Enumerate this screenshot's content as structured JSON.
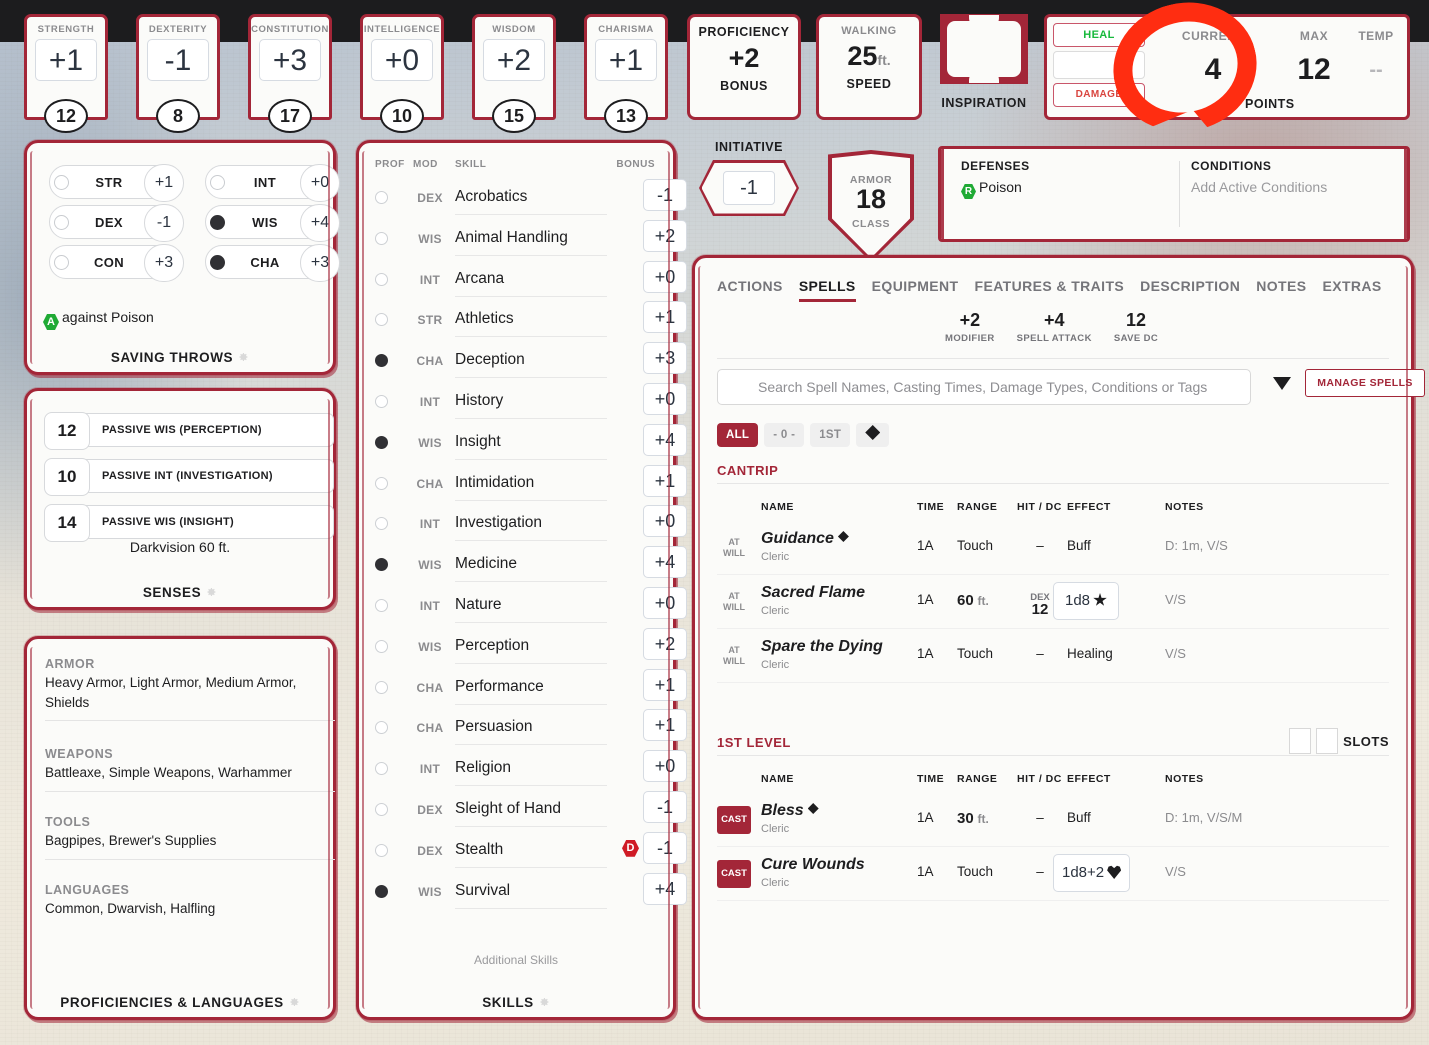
{
  "abilities": [
    {
      "name": "STRENGTH",
      "mod": "+1",
      "score": "12"
    },
    {
      "name": "DEXTERITY",
      "mod": "-1",
      "score": "8"
    },
    {
      "name": "CONSTITUTION",
      "mod": "+3",
      "score": "17"
    },
    {
      "name": "INTELLIGENCE",
      "mod": "+0",
      "score": "10"
    },
    {
      "name": "WISDOM",
      "mod": "+2",
      "score": "15"
    },
    {
      "name": "CHARISMA",
      "mod": "+1",
      "score": "13"
    }
  ],
  "proficiency": {
    "top": "PROFICIENCY",
    "value": "+2",
    "bottom": "BONUS"
  },
  "speed": {
    "top": "WALKING",
    "value": "25",
    "unit": "ft.",
    "bottom": "SPEED"
  },
  "inspiration": {
    "label": "INSPIRATION"
  },
  "hit_points": {
    "heal_label": "HEAL",
    "damage_label": "DAMAGE",
    "current_label": "CURRENT",
    "current_value": "4",
    "max_label": "MAX",
    "max_value": "12",
    "temp_label": "TEMP",
    "temp_value": "--",
    "footer": "HIT POINTS"
  },
  "saving_throws": {
    "footer": "SAVING THROWS",
    "rows": [
      {
        "name": "STR",
        "bonus": "+1",
        "proficient": false
      },
      {
        "name": "INT",
        "bonus": "+0",
        "proficient": false
      },
      {
        "name": "DEX",
        "bonus": "-1",
        "proficient": false
      },
      {
        "name": "WIS",
        "bonus": "+4",
        "proficient": true
      },
      {
        "name": "CON",
        "bonus": "+3",
        "proficient": false
      },
      {
        "name": "CHA",
        "bonus": "+3",
        "proficient": true
      }
    ],
    "note": "against Poison",
    "note_badge": "A"
  },
  "senses": {
    "footer": "SENSES",
    "rows": [
      {
        "value": "12",
        "label": "PASSIVE WIS (PERCEPTION)"
      },
      {
        "value": "10",
        "label": "PASSIVE INT (INVESTIGATION)"
      },
      {
        "value": "14",
        "label": "PASSIVE WIS (INSIGHT)"
      }
    ],
    "extra": "Darkvision 60 ft."
  },
  "proficiencies": {
    "footer": "PROFICIENCIES & LANGUAGES",
    "groups": [
      {
        "heading": "ARMOR",
        "content": "Heavy Armor, Light Armor, Medium Armor, Shields"
      },
      {
        "heading": "WEAPONS",
        "content": "Battleaxe, Simple Weapons, Warhammer"
      },
      {
        "heading": "TOOLS",
        "content": "Bagpipes, Brewer's Supplies"
      },
      {
        "heading": "LANGUAGES",
        "content": "Common, Dwarvish, Halfling"
      }
    ]
  },
  "skills": {
    "footer": "SKILLS",
    "headers": {
      "prof": "PROF",
      "mod": "MOD",
      "skill": "SKILL",
      "bonus": "BONUS"
    },
    "additional": "Additional Skills",
    "rows": [
      {
        "proficient": false,
        "mod": "DEX",
        "name": "Acrobatics",
        "bonus": "-1"
      },
      {
        "proficient": false,
        "mod": "WIS",
        "name": "Animal Handling",
        "bonus": "+2"
      },
      {
        "proficient": false,
        "mod": "INT",
        "name": "Arcana",
        "bonus": "+0"
      },
      {
        "proficient": false,
        "mod": "STR",
        "name": "Athletics",
        "bonus": "+1"
      },
      {
        "proficient": true,
        "mod": "CHA",
        "name": "Deception",
        "bonus": "+3"
      },
      {
        "proficient": false,
        "mod": "INT",
        "name": "History",
        "bonus": "+0"
      },
      {
        "proficient": true,
        "mod": "WIS",
        "name": "Insight",
        "bonus": "+4"
      },
      {
        "proficient": false,
        "mod": "CHA",
        "name": "Intimidation",
        "bonus": "+1"
      },
      {
        "proficient": false,
        "mod": "INT",
        "name": "Investigation",
        "bonus": "+0"
      },
      {
        "proficient": true,
        "mod": "WIS",
        "name": "Medicine",
        "bonus": "+4"
      },
      {
        "proficient": false,
        "mod": "INT",
        "name": "Nature",
        "bonus": "+0"
      },
      {
        "proficient": false,
        "mod": "WIS",
        "name": "Perception",
        "bonus": "+2"
      },
      {
        "proficient": false,
        "mod": "CHA",
        "name": "Performance",
        "bonus": "+1"
      },
      {
        "proficient": false,
        "mod": "CHA",
        "name": "Persuasion",
        "bonus": "+1"
      },
      {
        "proficient": false,
        "mod": "INT",
        "name": "Religion",
        "bonus": "+0"
      },
      {
        "proficient": false,
        "mod": "DEX",
        "name": "Sleight of Hand",
        "bonus": "-1"
      },
      {
        "proficient": false,
        "mod": "DEX",
        "name": "Stealth",
        "bonus": "-1",
        "disadvantage": "D"
      },
      {
        "proficient": true,
        "mod": "WIS",
        "name": "Survival",
        "bonus": "+4"
      }
    ]
  },
  "initiative": {
    "label": "INITIATIVE",
    "value": "-1"
  },
  "armor_class": {
    "top": "ARMOR",
    "value": "18",
    "bottom": "CLASS"
  },
  "defenses": {
    "heading": "DEFENSES",
    "badge": "R",
    "value": "Poison"
  },
  "conditions": {
    "heading": "CONDITIONS",
    "value": "Add Active Conditions"
  },
  "tabs": [
    {
      "label": "ACTIONS",
      "active": false
    },
    {
      "label": "SPELLS",
      "active": true
    },
    {
      "label": "EQUIPMENT",
      "active": false
    },
    {
      "label": "FEATURES & TRAITS",
      "active": false
    },
    {
      "label": "DESCRIPTION",
      "active": false
    },
    {
      "label": "NOTES",
      "active": false
    },
    {
      "label": "EXTRAS",
      "active": false
    }
  ],
  "spell_stats": [
    {
      "value": "+2",
      "label": "MODIFIER"
    },
    {
      "value": "+4",
      "label": "SPELL ATTACK"
    },
    {
      "value": "12",
      "label": "SAVE DC"
    }
  ],
  "search": {
    "placeholder": "Search Spell Names, Casting Times, Damage Types, Conditions or Tags",
    "value": ""
  },
  "manage_spells_label": "MANAGE SPELLS",
  "filter_pills": [
    {
      "label": "ALL",
      "active": true
    },
    {
      "label": "- 0 -",
      "active": false
    },
    {
      "label": "1ST",
      "active": false
    },
    {
      "label": "◆",
      "active": false
    }
  ],
  "spell_table_headers": {
    "name": "NAME",
    "time": "TIME",
    "range": "RANGE",
    "hit": "HIT / DC",
    "effect": "EFFECT",
    "notes": "NOTES"
  },
  "spell_sections": [
    {
      "title": "CANTRIP",
      "has_slots": false,
      "spells": [
        {
          "cast_label": "AT WILL",
          "cast_type": "atwill",
          "name": "Guidance",
          "concentration": true,
          "source": "Cleric",
          "time": "1A",
          "range": "Touch",
          "range_bold": "",
          "hit": "–",
          "dc_label": "",
          "dc_value": "",
          "effect": "Buff",
          "effect_boxed": false,
          "notes": "D: 1m, V/S"
        },
        {
          "cast_label": "AT WILL",
          "cast_type": "atwill",
          "name": "Sacred Flame",
          "concentration": false,
          "source": "Cleric",
          "time": "1A",
          "range": "ft.",
          "range_bold": "60",
          "hit": "",
          "dc_label": "DEX",
          "dc_value": "12",
          "effect": "1d8",
          "effect_boxed": true,
          "effect_icon": "damage-burst-icon",
          "notes": "V/S"
        },
        {
          "cast_label": "AT WILL",
          "cast_type": "atwill",
          "name": "Spare the Dying",
          "concentration": false,
          "source": "Cleric",
          "time": "1A",
          "range": "Touch",
          "range_bold": "",
          "hit": "–",
          "dc_label": "",
          "dc_value": "",
          "effect": "Healing",
          "effect_boxed": false,
          "notes": "V/S"
        }
      ]
    },
    {
      "title": "1ST LEVEL",
      "has_slots": true,
      "slots_label": "SLOTS",
      "slots_count": 2,
      "spells": [
        {
          "cast_label": "CAST",
          "cast_type": "cast",
          "name": "Bless",
          "concentration": true,
          "source": "Cleric",
          "time": "1A",
          "range": "ft.",
          "range_bold": "30",
          "hit": "–",
          "dc_label": "",
          "dc_value": "",
          "effect": "Buff",
          "effect_boxed": false,
          "notes": "D: 1m, V/S/M"
        },
        {
          "cast_label": "CAST",
          "cast_type": "cast",
          "name": "Cure Wounds",
          "concentration": false,
          "source": "Cleric",
          "time": "1A",
          "range": "Touch",
          "range_bold": "",
          "hit": "–",
          "dc_label": "",
          "dc_value": "",
          "effect": "1d8+2",
          "effect_boxed": true,
          "effect_icon": "heart-icon",
          "notes": "V/S"
        }
      ]
    }
  ],
  "colors": {
    "accent": "#a32638",
    "annotation": "#ff2d11",
    "resist": "#1faa35",
    "disadvantage": "#cf1b26"
  }
}
